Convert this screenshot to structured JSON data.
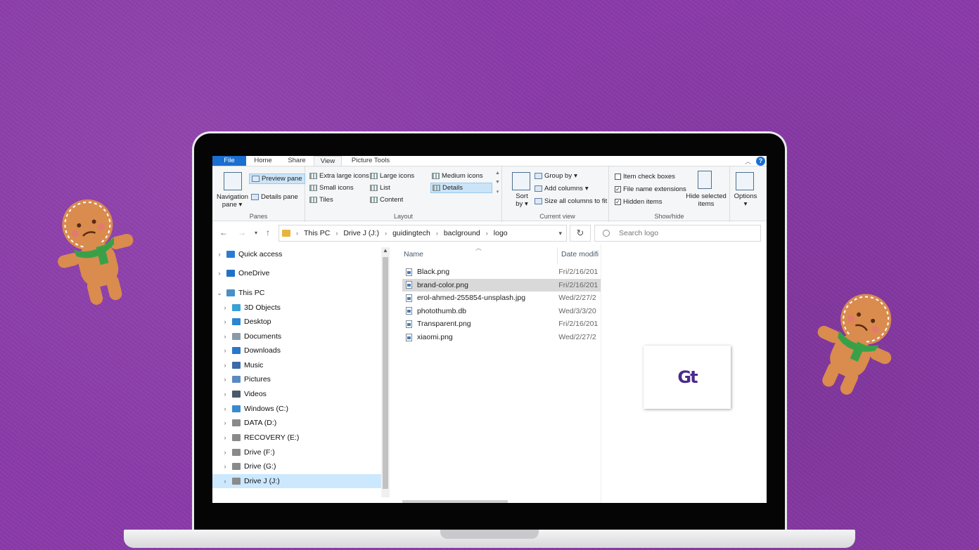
{
  "ribbon_tabs": [
    "File",
    "Home",
    "Share",
    "View",
    "Picture Tools"
  ],
  "help_label": "?",
  "panes": {
    "navigation_pane": "Navigation pane",
    "preview_pane": "Preview pane",
    "details_pane": "Details pane",
    "group_label": "Panes"
  },
  "layout": {
    "items": [
      "Extra large icons",
      "Large icons",
      "Medium icons",
      "Small icons",
      "List",
      "Details",
      "Tiles",
      "Content"
    ],
    "selected": "Details",
    "group_label": "Layout"
  },
  "current_view": {
    "sort_by": "Sort by",
    "group_by": "Group by",
    "add_columns": "Add columns",
    "size_all_columns": "Size all columns to fit",
    "group_label": "Current view"
  },
  "show_hide": {
    "item_check_boxes": {
      "label": "Item check boxes",
      "checked": false
    },
    "file_name_extensions": {
      "label": "File name extensions",
      "checked": true
    },
    "hidden_items": {
      "label": "Hidden items",
      "checked": true
    },
    "hide_selected_items": "Hide selected items",
    "group_label": "Show/hide"
  },
  "options_label": "Options",
  "breadcrumb": [
    "This PC",
    "Drive J (J:)",
    "guidingtech",
    "baclground",
    "logo"
  ],
  "search_placeholder": "Search logo",
  "nav_pane": {
    "items": [
      {
        "label": "Quick access",
        "icon": "star-icon",
        "color": "#2b7bd6"
      },
      {
        "label": "OneDrive",
        "icon": "cloud-icon",
        "color": "#1e73c8"
      },
      {
        "label": "This PC",
        "icon": "computer-icon",
        "color": "#4a90c8"
      },
      {
        "label": "3D Objects",
        "icon": "cube-icon",
        "color": "#3aa0d8"
      },
      {
        "label": "Desktop",
        "icon": "desktop-icon",
        "color": "#2a86d0"
      },
      {
        "label": "Documents",
        "icon": "document-icon",
        "color": "#8a9aa8"
      },
      {
        "label": "Downloads",
        "icon": "download-icon",
        "color": "#2a78c8"
      },
      {
        "label": "Music",
        "icon": "music-icon",
        "color": "#3a6aa8"
      },
      {
        "label": "Pictures",
        "icon": "picture-icon",
        "color": "#5a8ac0"
      },
      {
        "label": "Videos",
        "icon": "video-icon",
        "color": "#4a5a6a"
      },
      {
        "label": "Windows (C:)",
        "icon": "windows-drive-icon",
        "color": "#3a8ad0"
      },
      {
        "label": "DATA (D:)",
        "icon": "drive-icon",
        "color": "#8a8a8a"
      },
      {
        "label": "RECOVERY (E:)",
        "icon": "drive-icon",
        "color": "#8a8a8a"
      },
      {
        "label": "Drive (F:)",
        "icon": "drive-icon",
        "color": "#8a8a8a"
      },
      {
        "label": "Drive (G:)",
        "icon": "drive-icon",
        "color": "#8a8a8a"
      },
      {
        "label": "Drive J (J:)",
        "icon": "drive-icon",
        "color": "#8a8a8a"
      }
    ],
    "selected": "Drive J (J:)"
  },
  "file_list": {
    "columns": [
      "Name",
      "Date modifi"
    ],
    "rows": [
      {
        "name": "Black.png",
        "date": "Fri/2/16/201"
      },
      {
        "name": "brand-color.png",
        "date": "Fri/2/16/201"
      },
      {
        "name": "erol-ahmed-255854-unsplash.jpg",
        "date": "Wed/2/27/2"
      },
      {
        "name": "photothumb.db",
        "date": "Wed/3/3/20"
      },
      {
        "name": "Transparent.png",
        "date": "Fri/2/16/201"
      },
      {
        "name": "xiaomi.png",
        "date": "Wed/2/27/2"
      }
    ],
    "highlighted": "brand-color.png"
  },
  "preview_logo_text": "Gt",
  "colors": {
    "background": "#8a3aa8",
    "accent": "#1a6fd1",
    "selection": "#cce8ff",
    "logo": "#4b2a8a"
  }
}
